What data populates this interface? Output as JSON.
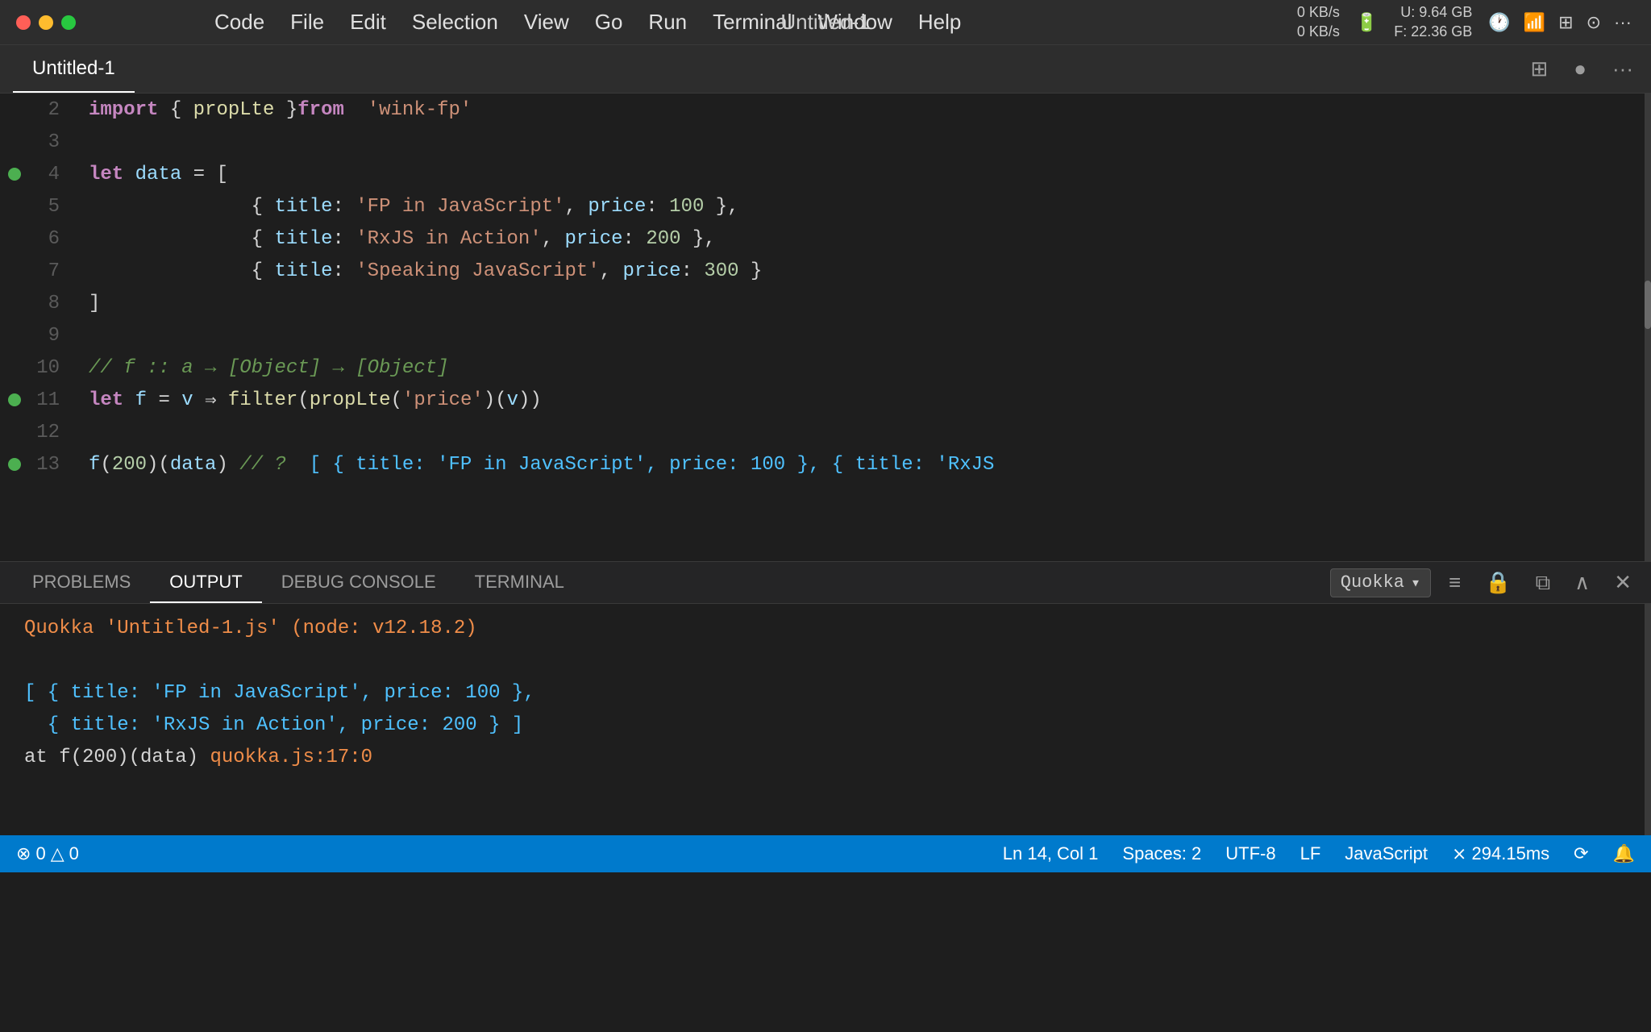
{
  "titlebar": {
    "title": "Untitled-1",
    "menu_items": [
      "",
      "Code",
      "File",
      "Edit",
      "Selection",
      "View",
      "Go",
      "Run",
      "Terminal",
      "Window",
      "Help"
    ]
  },
  "tab": {
    "label": "Untitled-1",
    "split_icon": "⊞",
    "circle_icon": "●",
    "more_icon": "···"
  },
  "editor": {
    "lines": [
      {
        "num": "2",
        "breakpoint": false,
        "code_html": "<span class='import-kw'>import</span> <span class='punc'>{ </span><span class='fn-name'>propLte</span><span class='punc'> }</span> <span class='from-kw'>from</span>  <span class='string'>'wink-fp'</span>"
      },
      {
        "num": "3",
        "breakpoint": false,
        "code_html": ""
      },
      {
        "num": "4",
        "breakpoint": true,
        "code_html": "<span class='kw-let'>let</span> <span class='var-name'>data</span> <span class='operator'>=</span> <span class='punc'>[</span>"
      },
      {
        "num": "5",
        "breakpoint": false,
        "code_html": "    <span class='punc'>{ </span><span class='obj-key'>title</span><span class='punc'>:</span> <span class='string'>'FP in JavaScript'</span><span class='punc'>,</span> <span class='obj-key'>price</span><span class='punc'>:</span> <span class='number'>100</span> <span class='punc'>},</span>"
      },
      {
        "num": "6",
        "breakpoint": false,
        "code_html": "    <span class='punc'>{ </span><span class='obj-key'>title</span><span class='punc'>:</span> <span class='string'>'RxJS in Action'</span><span class='punc'>,</span> <span class='obj-key'>price</span><span class='punc'>:</span> <span class='number'>200</span> <span class='punc'>},</span>"
      },
      {
        "num": "7",
        "breakpoint": false,
        "code_html": "    <span class='punc'>{ </span><span class='obj-key'>title</span><span class='punc'>:</span> <span class='string'>'Speaking JavaScript'</span><span class='punc'>,</span> <span class='obj-key'>price</span><span class='punc'>:</span> <span class='number'>300</span> <span class='punc'>}</span>"
      },
      {
        "num": "8",
        "breakpoint": false,
        "code_html": "<span class='punc'>]</span>"
      },
      {
        "num": "9",
        "breakpoint": false,
        "code_html": ""
      },
      {
        "num": "10",
        "breakpoint": false,
        "code_html": "<span class='comment'>// f :: a → [Object] → [Object]</span>"
      },
      {
        "num": "11",
        "breakpoint": true,
        "code_html": "<span class='kw-let'>let</span> <span class='var-name'>f</span> <span class='operator'>=</span> <span class='var-name'>v</span> <span class='arrow'>⇒</span> <span class='fn-name'>filter</span><span class='punc'>(</span><span class='fn-name'>propLte</span><span class='punc'>(</span><span class='string'>'price'</span><span class='punc'>)(</span><span class='var-name'>v</span><span class='punc'>))</span>"
      },
      {
        "num": "12",
        "breakpoint": false,
        "code_html": ""
      },
      {
        "num": "13",
        "breakpoint": true,
        "code_html": "<span class='var-name'>f</span><span class='punc'>(</span><span class='number'>200</span><span class='punc'>)(</span><span class='var-name'>data</span><span class='punc'>)</span> <span class='comment'>// ?</span>  <span class='output-data'>[ { title: 'FP in JavaScript', price: 100 }, { title: 'RxJS</span>"
      }
    ]
  },
  "panel": {
    "tabs": [
      "PROBLEMS",
      "OUTPUT",
      "DEBUG CONSOLE",
      "TERMINAL"
    ],
    "active_tab": "OUTPUT",
    "dropdown": "Quokka",
    "output_lines": [
      {
        "text": "Quokka 'Untitled-1.js' (node: v12.18.2)",
        "class": "output-quokka"
      },
      {
        "text": "",
        "class": ""
      },
      {
        "text": "[ { title: 'FP in JavaScript', price: 100 },",
        "class": "output-data"
      },
      {
        "text": "  { title: 'RxJS in Action', price: 200 } ]",
        "class": "output-data"
      },
      {
        "text": "at f(200)(data) quokka.js:17:0",
        "class": "output-at"
      }
    ]
  },
  "statusbar": {
    "errors": "⊗ 0",
    "warnings": "△ 0",
    "position": "Ln 14, Col 1",
    "spaces": "Spaces: 2",
    "encoding": "UTF-8",
    "line_ending": "LF",
    "language": "JavaScript",
    "perf": "⨯ 294.15ms",
    "notification_icon": "🔔",
    "share_icon": "⟳"
  },
  "network": {
    "down": "0 KB/s",
    "up": "0 KB/s"
  },
  "memory": {
    "u": "9.64 GB",
    "f": "22.36 GB"
  }
}
